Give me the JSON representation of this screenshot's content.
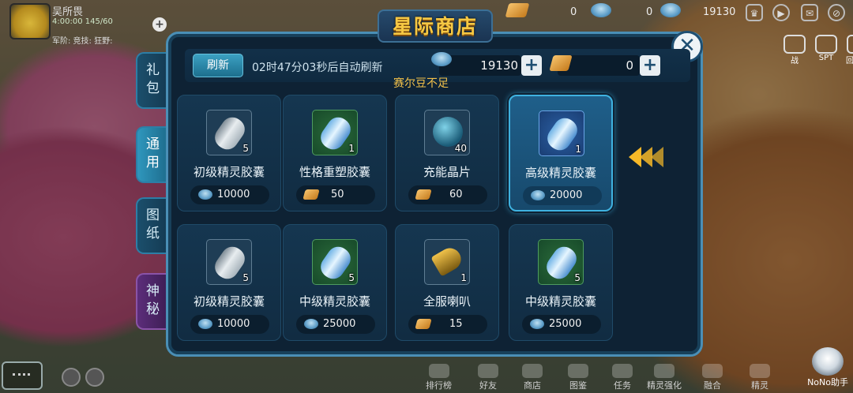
{
  "player": {
    "name": "吴所畏",
    "stats": "4:00:00  145/60",
    "tags": "军阶: 竞技: 狂野:"
  },
  "top_resources": [
    {
      "icon": "diamond-icon",
      "value": "0"
    },
    {
      "icon": "seer-bean-icon",
      "value": "0"
    },
    {
      "icon": "ship-icon",
      "value": "19130"
    }
  ],
  "shop": {
    "title": "星际商店",
    "refresh_label": "刷新",
    "refresh_timer": "02时47分03秒后自动刷新",
    "seer_beans": "19130",
    "diamonds": "0",
    "notice": "赛尔豆不足"
  },
  "tabs": [
    {
      "label": "礼包"
    },
    {
      "label": "通用"
    },
    {
      "label": "图纸"
    },
    {
      "label": "神秘"
    }
  ],
  "items": [
    {
      "name": "初级精灵胶囊",
      "qty": "5",
      "price": "10000",
      "currency": "seer-bean",
      "icon": "basic-capsule-icon"
    },
    {
      "name": "性格重塑胶囊",
      "qty": "1",
      "price": "50",
      "currency": "diamond",
      "icon": "personality-capsule-icon"
    },
    {
      "name": "充能晶片",
      "qty": "40",
      "price": "60",
      "currency": "diamond",
      "icon": "energy-chip-icon"
    },
    {
      "name": "高级精灵胶囊",
      "qty": "1",
      "price": "20000",
      "currency": "seer-bean",
      "icon": "advanced-capsule-icon"
    },
    {
      "name": "初级精灵胶囊",
      "qty": "5",
      "price": "10000",
      "currency": "seer-bean",
      "icon": "basic-capsule-icon"
    },
    {
      "name": "中级精灵胶囊",
      "qty": "5",
      "price": "25000",
      "currency": "seer-bean",
      "icon": "medium-capsule-icon"
    },
    {
      "name": "全服喇叭",
      "qty": "1",
      "price": "15",
      "currency": "diamond",
      "icon": "horn-icon"
    },
    {
      "name": "中级精灵胶囊",
      "qty": "5",
      "price": "25000",
      "currency": "seer-bean",
      "icon": "medium-capsule-icon"
    }
  ],
  "right_icons": [
    {
      "label": "战"
    },
    {
      "label": "SPT"
    },
    {
      "label": "回基地"
    }
  ],
  "bottom_nav": [
    {
      "label": "排行榜"
    },
    {
      "label": "好友"
    },
    {
      "label": "商店"
    },
    {
      "label": "图鉴"
    },
    {
      "label": "任务"
    },
    {
      "label": "精灵强化"
    },
    {
      "label": "融合"
    },
    {
      "label": "精灵"
    }
  ],
  "assistant": {
    "label": "NoNo助手"
  },
  "colors": {
    "accent": "#3fb2e0",
    "title_gold": "#f6c843",
    "notice": "#f2c14a",
    "panel": "#0e2234"
  }
}
